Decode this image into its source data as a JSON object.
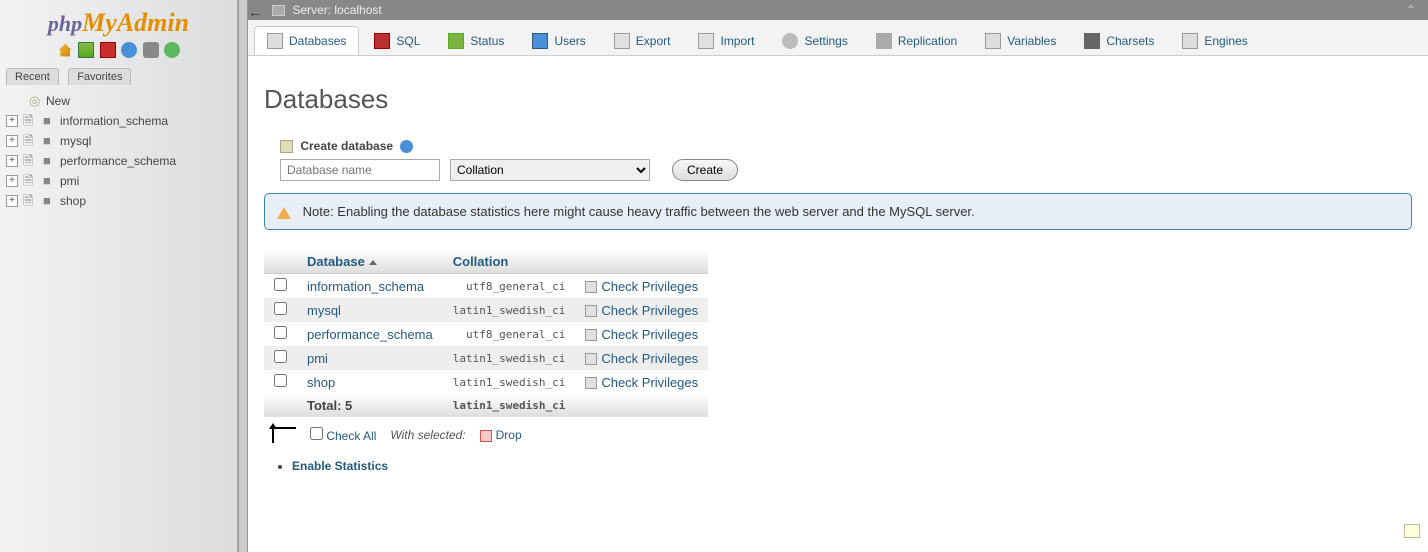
{
  "logo": {
    "part1": "php",
    "part2": "MyAdmin"
  },
  "sidebar_tabs": {
    "recent": "Recent",
    "favorites": "Favorites"
  },
  "tree": {
    "new": "New",
    "items": [
      {
        "label": "information_schema"
      },
      {
        "label": "mysql"
      },
      {
        "label": "performance_schema"
      },
      {
        "label": "pmi"
      },
      {
        "label": "shop"
      }
    ]
  },
  "breadcrumb": {
    "server_label": "Server:",
    "server_name": "localhost"
  },
  "tabs": [
    {
      "label": "Databases",
      "icon": "ti-db",
      "active": true
    },
    {
      "label": "SQL",
      "icon": "ti-sql"
    },
    {
      "label": "Status",
      "icon": "ti-status"
    },
    {
      "label": "Users",
      "icon": "ti-users"
    },
    {
      "label": "Export",
      "icon": "ti-export"
    },
    {
      "label": "Import",
      "icon": "ti-import"
    },
    {
      "label": "Settings",
      "icon": "ti-settings"
    },
    {
      "label": "Replication",
      "icon": "ti-repl"
    },
    {
      "label": "Variables",
      "icon": "ti-vars"
    },
    {
      "label": "Charsets",
      "icon": "ti-charsets"
    },
    {
      "label": "Engines",
      "icon": "ti-engines"
    }
  ],
  "page_title": "Databases",
  "create": {
    "heading": "Create database",
    "placeholder": "Database name",
    "collation_placeholder": "Collation",
    "button": "Create"
  },
  "notice": "Note: Enabling the database statistics here might cause heavy traffic between the web server and the MySQL server.",
  "table": {
    "col_db": "Database",
    "col_coll": "Collation",
    "rows": [
      {
        "db": "information_schema",
        "coll": "utf8_general_ci",
        "action": "Check Privileges"
      },
      {
        "db": "mysql",
        "coll": "latin1_swedish_ci",
        "action": "Check Privileges"
      },
      {
        "db": "performance_schema",
        "coll": "utf8_general_ci",
        "action": "Check Privileges"
      },
      {
        "db": "pmi",
        "coll": "latin1_swedish_ci",
        "action": "Check Privileges"
      },
      {
        "db": "shop",
        "coll": "latin1_swedish_ci",
        "action": "Check Privileges"
      }
    ],
    "total_label": "Total: 5",
    "total_coll": "latin1_swedish_ci"
  },
  "footer": {
    "check_all": "Check All",
    "with_selected": "With selected:",
    "drop": "Drop"
  },
  "enable_stats": "Enable Statistics"
}
